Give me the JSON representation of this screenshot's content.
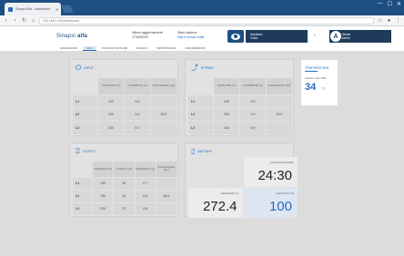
{
  "browser": {
    "tab_title": "Sinapsi Alfa - dashboard",
    "url": "192.168.1.100/dashboard",
    "win_min": "—",
    "win_max": "☐",
    "win_close": "✕"
  },
  "header": {
    "logo_light": "Sinapsi ",
    "logo_bold": "alfa",
    "info1_label": "Ultimo aggiornamento",
    "info1_value": "17/09/2019",
    "info2_label": "Stato sistema",
    "info2_value": "Dati in tempo reale",
    "user1_line1": "Impianto",
    "user1_line2": "Casa",
    "user2_line1": "Utente",
    "user2_line2": "Admin",
    "avatar_letter": "A"
  },
  "nav": {
    "tabs": [
      {
        "label": "DASHBOARD",
        "active": false
      },
      {
        "label": "FASI",
        "active": true
      },
      {
        "label": "STORICO CONSUMI",
        "active": false
      },
      {
        "label": "GRAFICI",
        "active": false
      },
      {
        "label": "IMPOSTAZIONI",
        "active": false
      },
      {
        "label": "INFORMAZIONI",
        "active": false
      }
    ]
  },
  "cards": {
    "input": {
      "title": "Input",
      "headers": [
        "",
        "TENSIONE (V)",
        "CORRENTE (A)",
        "FREQUENZA (Hz)"
      ],
      "rows": [
        [
          "L1",
          "230",
          "5.5",
          ""
        ],
        [
          "L2",
          "232",
          "5.4",
          "49.9"
        ],
        [
          "L3",
          "230",
          "5.7",
          ""
        ]
      ]
    },
    "bypass": {
      "title": "Bypass",
      "headers": [
        "",
        "TENSIONE (V)",
        "CORRENTE (A)",
        "FREQUENZA (Hz)"
      ],
      "rows": [
        [
          "L1",
          "230",
          "0.9",
          ""
        ],
        [
          "L2",
          "229",
          "0.9",
          "49.9"
        ],
        [
          "L3",
          "234",
          "0.9",
          ""
        ]
      ]
    },
    "output": {
      "title": "Output",
      "headers": [
        "",
        "TENSIONE (V)",
        "CARICO (%)",
        "CORRENTE (A)",
        "FREQUENZA (Hz)"
      ],
      "rows": [
        [
          "L1",
          "230",
          "26",
          "0.7",
          ""
        ],
        [
          "L2",
          "230",
          "26",
          "0.9",
          "49.9"
        ],
        [
          "L3",
          "229",
          "27",
          "0.8",
          ""
        ]
      ]
    },
    "battery": {
      "title": "Battery",
      "autonomy_label": "AUTONOMIA (MIN)",
      "autonomy_value": "24:30",
      "voltage_label": "TENSIONE (V)",
      "voltage_value": "272.4",
      "capacity_label": "CAPACITÀ (%)",
      "capacity_value": "100"
    }
  },
  "side": {
    "title": "TEMPERATURA",
    "label": "Inverter max 40%",
    "value": "34",
    "unit": "°C"
  },
  "icons": {
    "input": "plug-icon",
    "bypass": "bypass-icon",
    "output": "output-icon",
    "battery": "battery-icon"
  },
  "colors": {
    "accent": "#1e6fc4",
    "header_dark": "#1f3b5c",
    "browser_bar": "#1e4f82"
  }
}
